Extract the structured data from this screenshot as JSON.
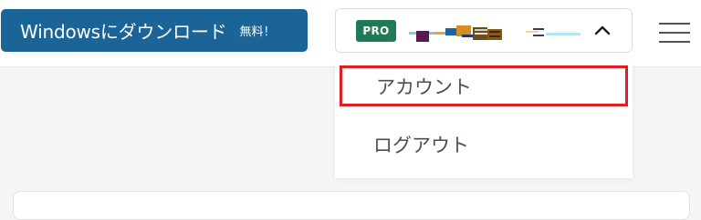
{
  "header": {
    "download_button": {
      "label": "Windowsにダウンロード",
      "badge": "無料！"
    },
    "account_toggle": {
      "pro_badge": "PRO",
      "username_redacted": true,
      "chevron_icon": "chevron-up-icon"
    },
    "menu_icon": "hamburger-menu-icon"
  },
  "account_dropdown": {
    "items": [
      {
        "label": "アカウント",
        "highlighted": true
      },
      {
        "label": "ログアウト",
        "highlighted": false
      }
    ]
  },
  "colors": {
    "brand_blue": "#1a6497",
    "pro_green": "#1f7a55",
    "highlight_red": "#e01e25",
    "page_background": "#f5f5f5",
    "menu_text": "#4a4f57"
  }
}
